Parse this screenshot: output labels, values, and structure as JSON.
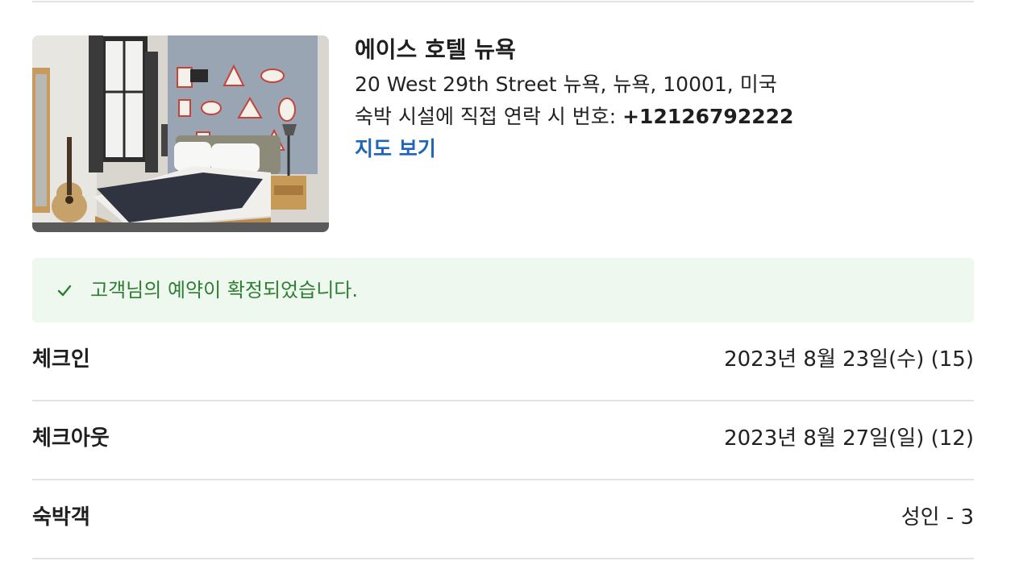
{
  "hotel": {
    "name": "에이스 호텔 뉴욕",
    "address": "20 West 29th Street 뉴욕, 뉴욕, 10001, 미국",
    "phone_prefix": "숙박 시설에 직접 연락 시 번호: ",
    "phone_number": "+12126792222",
    "map_link": "지도 보기"
  },
  "confirmation": {
    "icon": "check-icon",
    "message": "고객님의 예약이 확정되었습니다.",
    "color": "#2f7d32",
    "background": "#eef8ef"
  },
  "details": {
    "checkin": {
      "label": "체크인",
      "value": "2023년 8월 23일(수) (15)"
    },
    "checkout": {
      "label": "체크아웃",
      "value": "2023년 8월 27일(일) (12)"
    },
    "guests": {
      "label": "숙박객",
      "value": "성인 - 3"
    }
  },
  "colors": {
    "link": "#1f66b8",
    "divider": "#e3e3e3"
  }
}
